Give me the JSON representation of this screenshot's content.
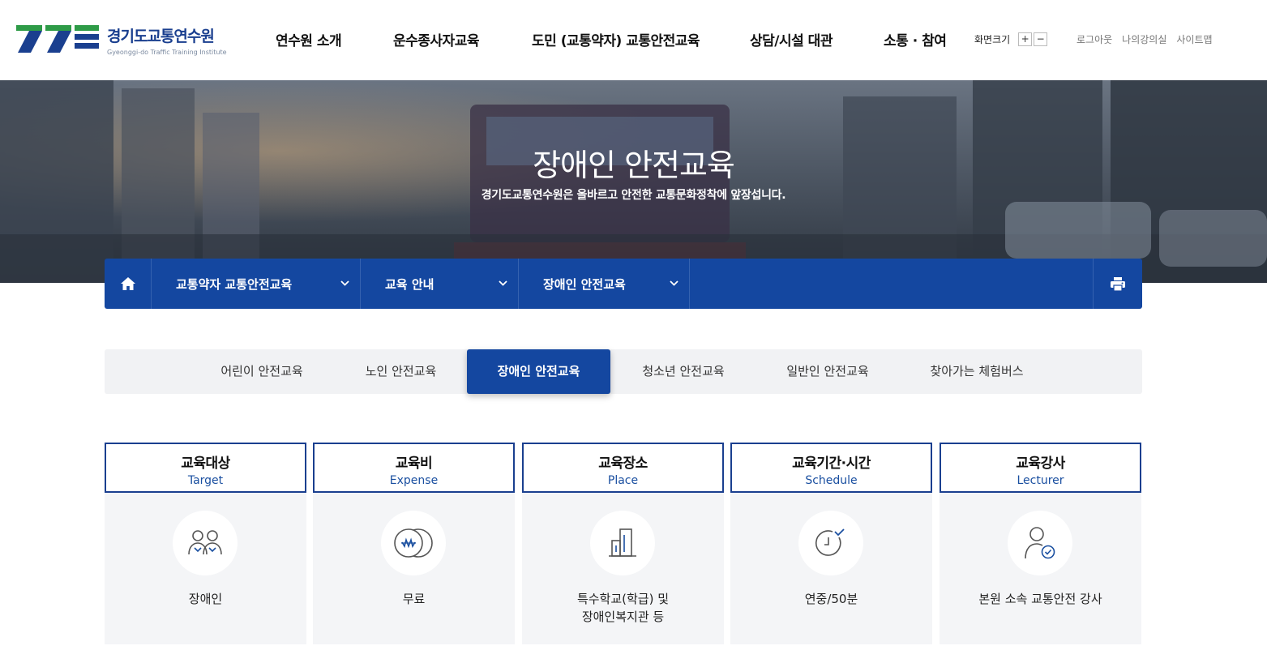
{
  "header": {
    "logo_kr": "경기도교통연수원",
    "logo_en": "Gyeonggi-do Traffic Training Institute",
    "gnb": [
      "연수원 소개",
      "운수종사자교육",
      "도민 (교통약자) 교통안전교육",
      "상담/시설 대관",
      "소통 · 참여"
    ],
    "zoom_label": "화면크기",
    "zoom_plus": "+",
    "zoom_minus": "−",
    "util": [
      "로그아웃",
      "나의강의실",
      "사이트맵"
    ]
  },
  "hero": {
    "title": "장애인 안전교육",
    "subtitle": "경기도교통연수원은 올바르고 안전한 교통문화정착에 앞장섭니다."
  },
  "breadcrumb": {
    "items": [
      "교통약자 교통안전교육",
      "교육 안내",
      "장애인 안전교육"
    ]
  },
  "tabs": {
    "items": [
      "어린이 안전교육",
      "노인 안전교육",
      "장애인 안전교육",
      "청소년 안전교육",
      "일반인 안전교육",
      "찾아가는 체험버스"
    ],
    "active_index": 2
  },
  "cards": [
    {
      "title_kr": "교육대상",
      "title_en": "Target",
      "icon": "people-icon",
      "text": "장애인"
    },
    {
      "title_kr": "교육비",
      "title_en": "Expense",
      "icon": "coin-icon",
      "text": "무료"
    },
    {
      "title_kr": "교육장소",
      "title_en": "Place",
      "icon": "building-icon",
      "text": "특수학교(학급) 및\n장애인복지관 등"
    },
    {
      "title_kr": "교육기간·시간",
      "title_en": "Schedule",
      "icon": "clock-check-icon",
      "text": "연중/50분"
    },
    {
      "title_kr": "교육강사",
      "title_en": "Lecturer",
      "icon": "lecturer-icon",
      "text": "본원 소속 교통안전 강사"
    }
  ],
  "colors": {
    "primary": "#1447a0",
    "logo_green": "#2e9b47",
    "logo_blue": "#1a3f8f",
    "tab_bg": "#f1f2f4",
    "card_bg": "#f4f5f7"
  }
}
